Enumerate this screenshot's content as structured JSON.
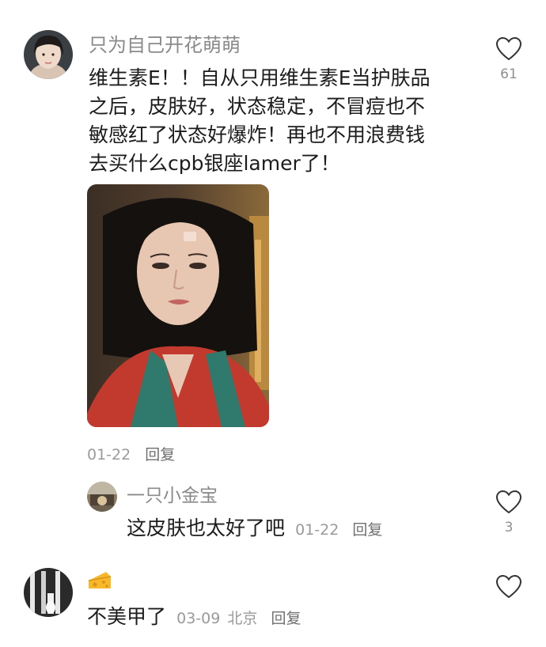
{
  "comments": [
    {
      "username": "只为自己开花萌萌",
      "text_lines": [
        "维生素E！！自从只用维生素E当护肤品",
        "之后，皮肤好，状态稳定，不冒痘也不",
        "敏感红了状态好爆炸！再也不用浪费钱",
        "去买什么cpb银座lamer了！"
      ],
      "date": "01-22",
      "reply_label": "回复",
      "likes": "61",
      "icons": {
        "like": "heart-outline-icon"
      }
    },
    {
      "username": "一只小金宝",
      "text": "这皮肤也太好了吧",
      "date": "01-22",
      "reply_label": "回复",
      "likes": "3",
      "icons": {
        "like": "heart-outline-icon"
      }
    },
    {
      "username_icon": "cheese-emoji",
      "text": "不美甲了",
      "date": "03-09",
      "location": "北京",
      "reply_label": "回复",
      "icons": {
        "like": "heart-outline-icon"
      }
    }
  ],
  "colors": {
    "text": "#1c1c1c",
    "muted": "#8a8a8a",
    "background": "#ffffff"
  }
}
